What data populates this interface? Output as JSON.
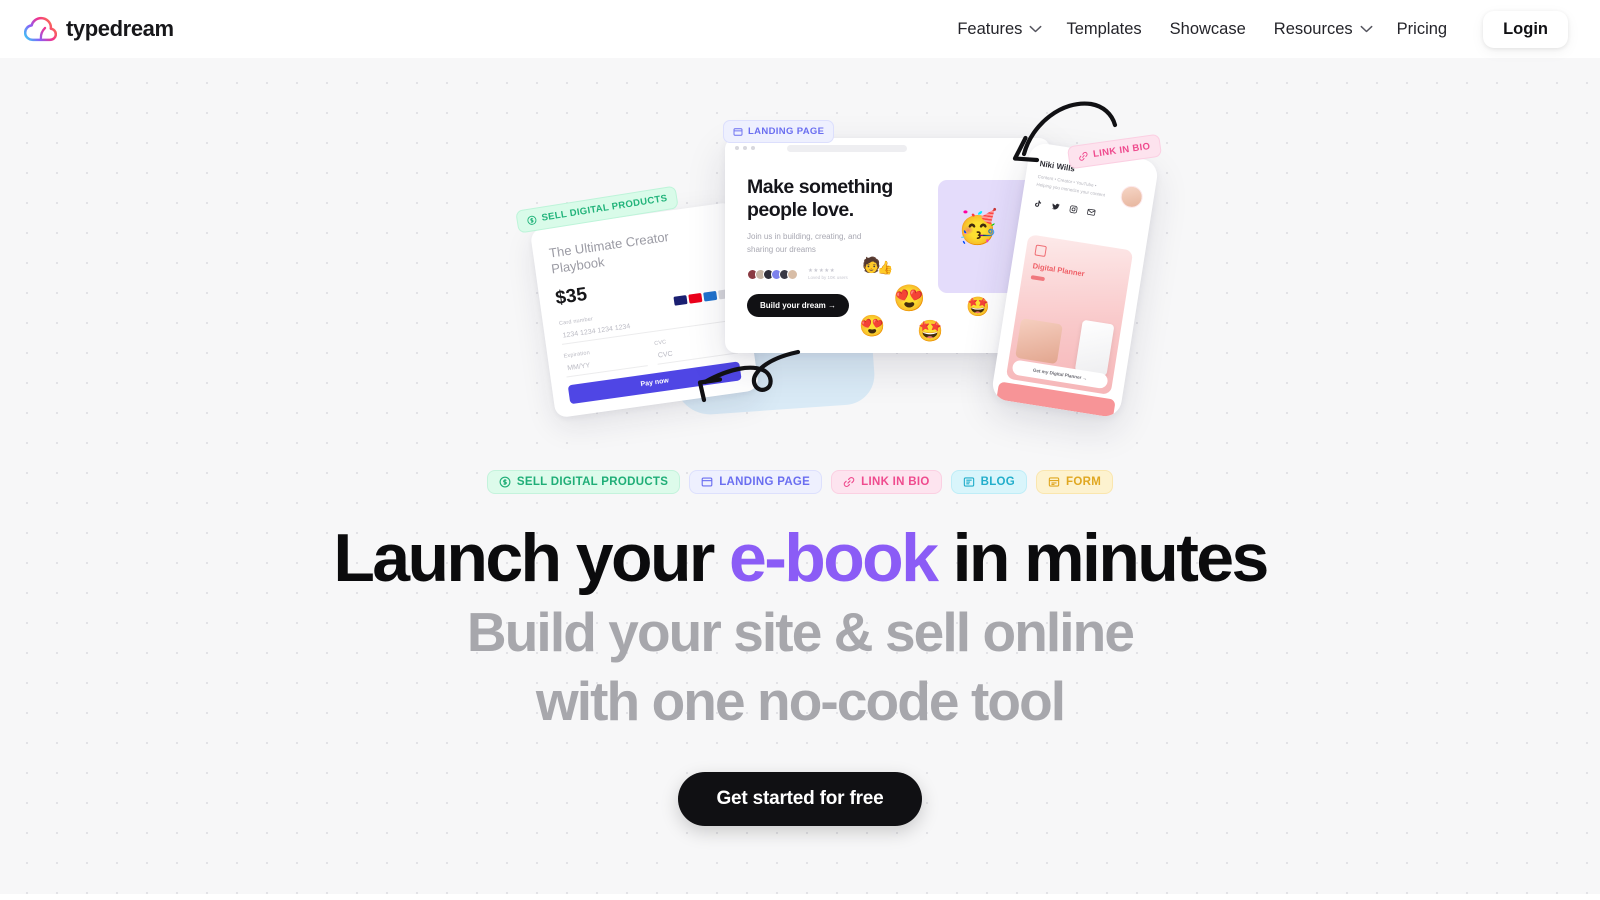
{
  "brand": {
    "name": "typedream",
    "logo_icon": "cloud-logo-icon"
  },
  "nav": {
    "items": [
      {
        "label": "Features",
        "has_dropdown": true
      },
      {
        "label": "Templates",
        "has_dropdown": false
      },
      {
        "label": "Showcase",
        "has_dropdown": false
      },
      {
        "label": "Resources",
        "has_dropdown": true
      },
      {
        "label": "Pricing",
        "has_dropdown": false
      }
    ],
    "login_label": "Login"
  },
  "hero": {
    "headline_pre": "Launch your ",
    "headline_accent": "e-book",
    "headline_post": " in minutes",
    "accent_color": "#8b5cf6",
    "subheadline_line1": "Build your site & sell online",
    "subheadline_line2": "with one no-code tool",
    "cta_label": "Get started for free"
  },
  "pills": [
    {
      "label": "SELL DIGITAL PRODUCTS",
      "icon": "dollar-circle-icon",
      "color": "#1fae77",
      "bg": "#ddfbeb"
    },
    {
      "label": "LANDING PAGE",
      "icon": "browser-window-icon",
      "color": "#6a6ef0",
      "bg": "#eef0fe"
    },
    {
      "label": "LINK IN BIO",
      "icon": "link-icon",
      "color": "#ef4b8e",
      "bg": "#fde4ef"
    },
    {
      "label": "BLOG",
      "icon": "article-icon",
      "color": "#22aecb",
      "bg": "#d9f5fb"
    },
    {
      "label": "FORM",
      "icon": "form-icon",
      "color": "#e0a721",
      "bg": "#fdf2cf"
    }
  ],
  "artwork": {
    "float_tags": [
      {
        "label": "SELL DIGITAL PRODUCTS",
        "icon": "dollar-circle-icon"
      },
      {
        "label": "LANDING PAGE",
        "icon": "browser-window-icon"
      },
      {
        "label": "LINK IN BIO",
        "icon": "link-icon"
      }
    ],
    "checkout_card": {
      "product_title": "The Ultimate Creator Playbook",
      "price": "$35",
      "card_number_label": "Card number",
      "card_number_value": "1234 1234 1234 1234",
      "expiry_label": "Expiration",
      "expiry_value": "MM/YY",
      "cvc_label": "CVC",
      "cvc_value": "CVC",
      "pay_button": "Pay now"
    },
    "browser_card": {
      "headline": "Make something people love.",
      "subtext": "Join us in building, creating, and sharing our dreams",
      "rating_stars": "★★★★★",
      "rating_text": "Loved by 10K users",
      "cta": "Build your dream  →"
    },
    "phone_card": {
      "name": "Niki Wills",
      "bio": "Content  •  Creator  •  YouTube  •  Helping you monetize your content",
      "social_icons": [
        "tiktok-icon",
        "twitter-icon",
        "instagram-icon",
        "email-icon"
      ],
      "product_title": "Digital Planner",
      "button": "Get my Digital Planner  →"
    }
  }
}
